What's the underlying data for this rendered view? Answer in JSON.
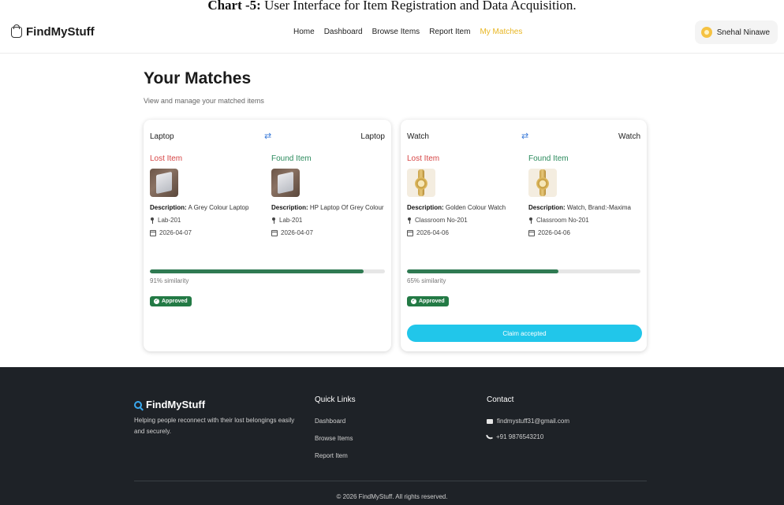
{
  "caption": {
    "bold": "Chart -5:",
    "text": " User Interface for Item Registration and Data Acquisition."
  },
  "nav": {
    "brand": "FindMyStuff",
    "links": [
      "Home",
      "Dashboard",
      "Browse Items",
      "Report Item",
      "My Matches"
    ],
    "active_index": 4,
    "user_name": "Snehal Ninawe",
    "active_color": "#e8b623"
  },
  "page": {
    "title": "Your Matches",
    "subtitle": "View and manage your matched items"
  },
  "matches": [
    {
      "lost_title": "Laptop",
      "swap_icon": "⇄",
      "found_title": "Laptop",
      "lost_label": "Lost Item",
      "found_label": "Found Item",
      "lost_image": "laptop",
      "found_image": "laptop",
      "lost_desc_label": "Description:",
      "lost_desc": " A Grey Colour Laptop",
      "found_desc_label": "Description:",
      "found_desc": " HP Laptop Of Grey Colour",
      "lost_location": "Lab-201",
      "found_location": "Lab-201",
      "lost_date": "2026-04-07",
      "found_date": "2026-04-07",
      "similarity_pct": 91,
      "similarity_text": "91% similarity",
      "status": "Approved",
      "claim_button": null
    },
    {
      "lost_title": "Watch",
      "swap_icon": "⇄",
      "found_title": "Watch",
      "lost_label": "Lost Item",
      "found_label": "Found Item",
      "lost_image": "watch",
      "found_image": "watch",
      "lost_desc_label": "Description:",
      "lost_desc": " Golden Colour Watch",
      "found_desc_label": "Description:",
      "found_desc": " Watch, Brand:-Maxima",
      "lost_location": "Classroom No-201",
      "found_location": "Classroom No-201",
      "lost_date": "2026-04-06",
      "found_date": "2026-04-06",
      "similarity_pct": 65,
      "similarity_text": "65% similarity",
      "status": "Approved",
      "claim_button": "Claim accepted"
    }
  ],
  "footer": {
    "brand": "FindMyStuff",
    "tagline": "Helping people reconnect with their lost belongings easily and securely.",
    "quick_links_title": "Quick Links",
    "quick_links": [
      "Dashboard",
      "Browse Items",
      "Report Item"
    ],
    "contact_title": "Contact",
    "email": "findmystuff31@gmail.com",
    "phone": "+91 9876543210",
    "copyright": "© 2026 FindMyStuff. All rights reserved."
  },
  "colors": {
    "progress_fill": "#2f7a52",
    "approved_badge": "#237a45",
    "claim_button": "#21c6ea",
    "lost_label": "#d64545",
    "found_label": "#2a8a5c",
    "footer_bg": "#1e2227"
  }
}
